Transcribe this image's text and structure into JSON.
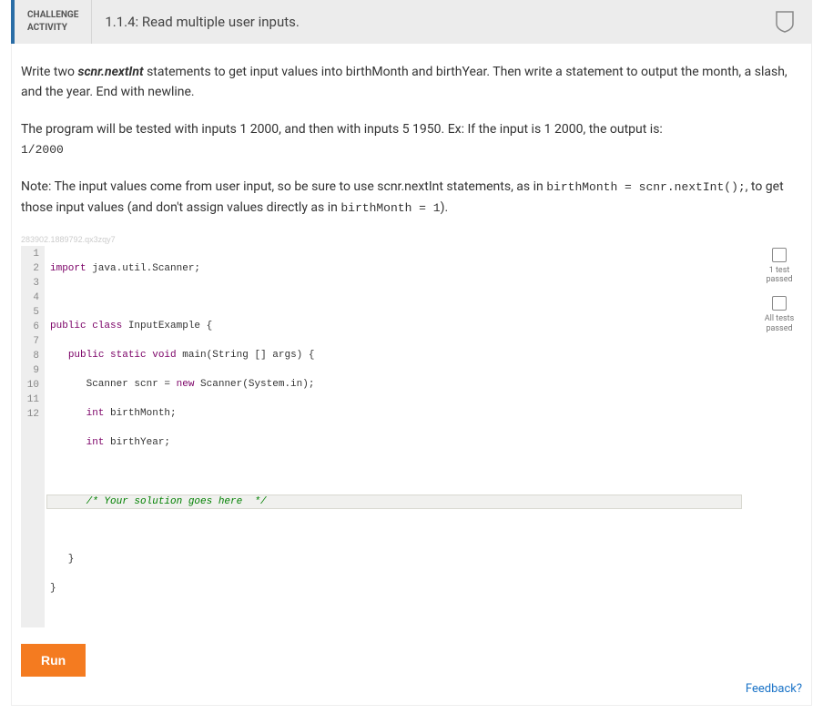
{
  "header": {
    "label_line1": "CHALLENGE",
    "label_line2": "ACTIVITY",
    "title": "1.1.4: Read multiple user inputs."
  },
  "instructions": {
    "p1_a": "Write two ",
    "p1_bi": "scnr.nextInt",
    "p1_b": " statements to get input values into birthMonth and birthYear. Then write a statement to output the month, a slash, and the year. End with newline.",
    "p2": "The program will be tested with inputs 1 2000, and then with inputs 5 1950. Ex: If the input is 1 2000, the output is:",
    "p2_out": "1/2000",
    "p3_a": "Note: The input values come from user input, so be sure to use scnr.nextInt statements, as in ",
    "p3_code1": "birthMonth = scnr.nextInt();",
    "p3_b": ", to get those input values (and don't assign values directly as in ",
    "p3_code2": "birthMonth = 1",
    "p3_c": ")."
  },
  "watermark": "283902.1889792.qx3zqy7",
  "code": {
    "line1_kw": "import",
    "line1_rest": " java.util.Scanner;",
    "line3_kw": "public class",
    "line3_name": " InputExample {",
    "line4_kw": "public static void",
    "line4_name": " main",
    "line4_sig": "(String [] args) {",
    "line5_a": "      Scanner scnr = ",
    "line5_kw": "new",
    "line5_b": " Scanner(System.in);",
    "line6_kw": "int",
    "line6_b": " birthMonth;",
    "line7_kw": "int",
    "line7_b": " birthYear;",
    "line9_cmt": "/* Your solution goes here  */",
    "line11": "   }",
    "line12": "}"
  },
  "lineNumbers": [
    "1",
    "2",
    "3",
    "4",
    "5",
    "6",
    "7",
    "8",
    "9",
    "10",
    "11",
    "12"
  ],
  "status": {
    "box1_label": "1 test passed",
    "box2_label": "All tests passed"
  },
  "run_label": "Run",
  "feedback_label": "Feedback?"
}
